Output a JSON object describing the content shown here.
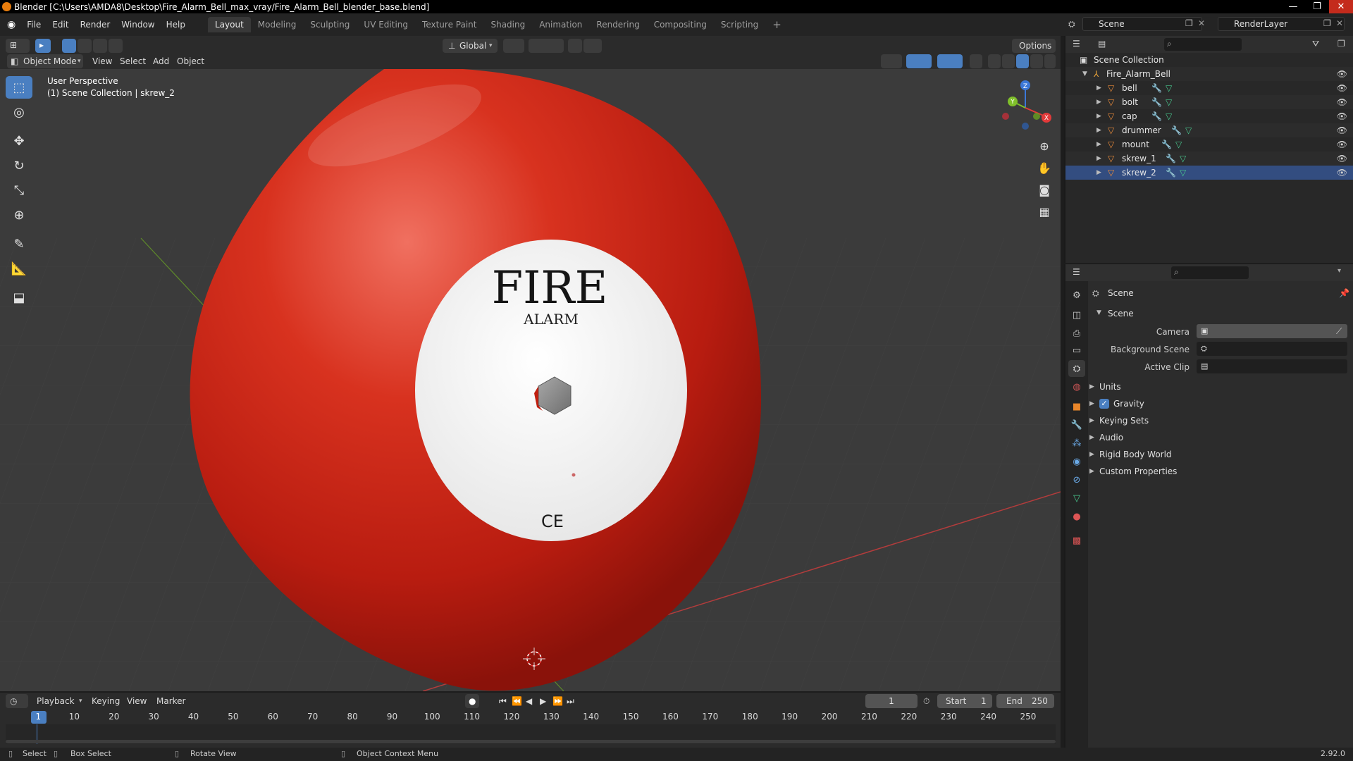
{
  "window": {
    "title": "Blender [C:\\Users\\AMDA8\\Desktop\\Fire_Alarm_Bell_max_vray/Fire_Alarm_Bell_blender_base.blend]",
    "minimize": "—",
    "maximize": "❐",
    "close": "✕"
  },
  "menu": [
    "File",
    "Edit",
    "Render",
    "Window",
    "Help"
  ],
  "workspaces": [
    "Layout",
    "Modeling",
    "Sculpting",
    "UV Editing",
    "Texture Paint",
    "Shading",
    "Animation",
    "Rendering",
    "Compositing",
    "Scripting"
  ],
  "add_workspace": "+",
  "scene_selector": "Scene",
  "renderlayer_selector": "RenderLayer",
  "viewport": {
    "transform_orientation": "Global",
    "options": "Options",
    "mode": "Object Mode",
    "header_menus": [
      "View",
      "Select",
      "Add",
      "Object"
    ],
    "overlay_line1": "User Perspective",
    "overlay_line2": "(1) Scene Collection | skrew_2",
    "label_main": "FIRE",
    "label_sub": "ALARM",
    "ce_mark": "CE",
    "gizmo": {
      "x": "X",
      "y": "Y",
      "z": "Z"
    }
  },
  "outliner": {
    "root": "Scene Collection",
    "collection": "Fire_Alarm_Bell",
    "objects": [
      "bell",
      "bolt",
      "cap",
      "drummer",
      "mount",
      "skrew_1",
      "skrew_2"
    ],
    "selected": "skrew_2"
  },
  "properties": {
    "context": "Scene",
    "panel": "Scene",
    "fields": [
      {
        "label": "Camera"
      },
      {
        "label": "Background Scene"
      },
      {
        "label": "Active Clip"
      }
    ],
    "subpanels": [
      "Units",
      "Gravity",
      "Keying Sets",
      "Audio",
      "Rigid Body World",
      "Custom Properties"
    ],
    "gravity_checked": true
  },
  "timeline": {
    "menus": [
      "Playback",
      "Keying",
      "View",
      "Marker"
    ],
    "current_frame": "1",
    "start_label": "Start",
    "start": "1",
    "end_label": "End",
    "end": "250",
    "ruler_ticks": [
      "1",
      "10",
      "20",
      "30",
      "40",
      "50",
      "60",
      "70",
      "80",
      "90",
      "100",
      "110",
      "120",
      "130",
      "140",
      "150",
      "160",
      "170",
      "180",
      "190",
      "200",
      "210",
      "220",
      "230",
      "240",
      "250"
    ]
  },
  "statusbar": {
    "select": "Select",
    "box_select": "Box Select",
    "rotate_view": "Rotate View",
    "context_menu": "Object Context Menu",
    "version": "2.92.0"
  }
}
